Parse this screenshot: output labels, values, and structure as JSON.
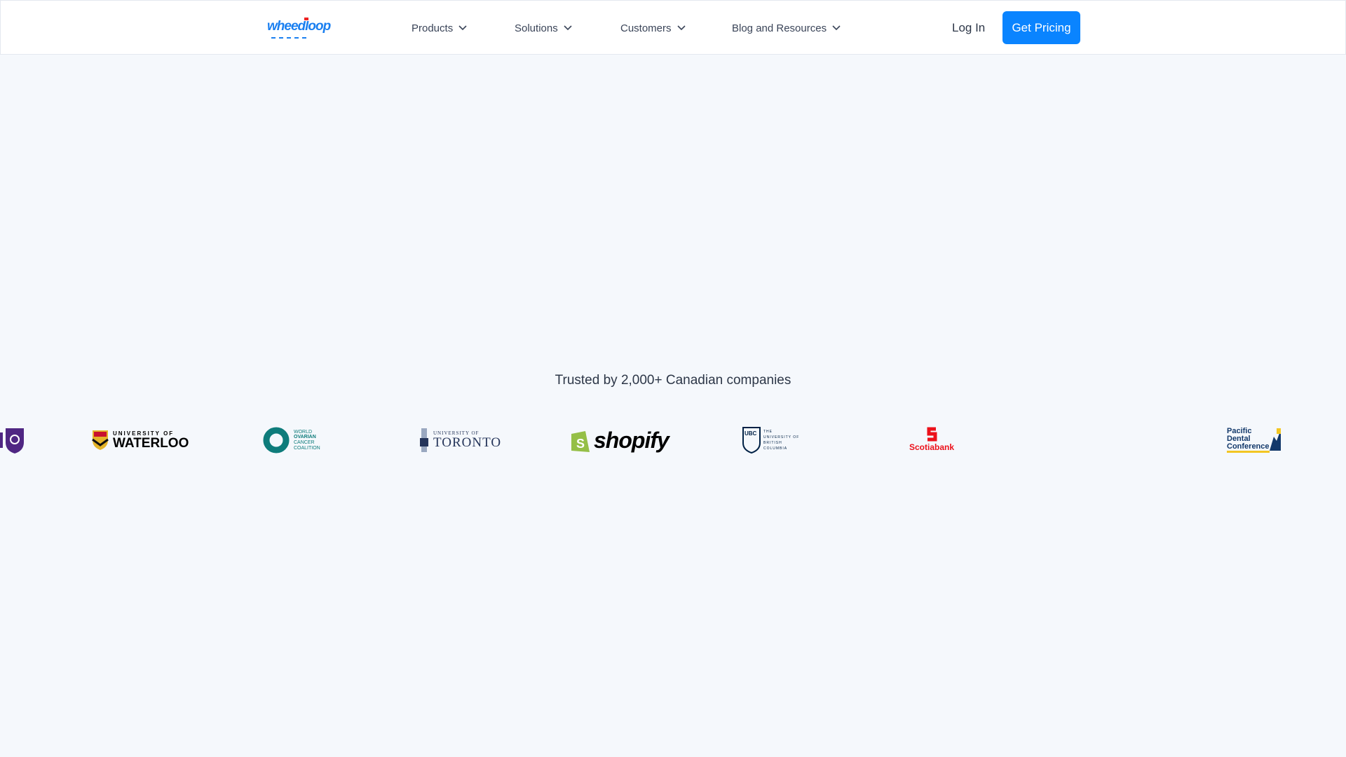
{
  "header": {
    "logo_text": "wheedloop",
    "nav": [
      {
        "label": "Products"
      },
      {
        "label": "Solutions"
      },
      {
        "label": "Customers"
      },
      {
        "label": "Blog and Resources"
      }
    ],
    "login": "Log In",
    "cta": "Get Pricing"
  },
  "trusted": {
    "text": "Trusted by 2,000+ Canadian companies",
    "logos": [
      {
        "name": "Western University",
        "text": ""
      },
      {
        "name": "University of Waterloo",
        "text": "UNIVERSITY OF WATERLOO"
      },
      {
        "name": "World Ovarian Cancer Coalition",
        "text": "WORLD OVARIAN CANCER COALITION"
      },
      {
        "name": "University of Toronto",
        "text": "UNIVERSITY OF TORONTO"
      },
      {
        "name": "Shopify",
        "text": "shopify"
      },
      {
        "name": "UBC",
        "text": "THE UNIVERSITY OF BRITISH COLUMBIA"
      },
      {
        "name": "Scotiabank",
        "text": "Scotiabank"
      },
      {
        "name": "Pacific Dental Conference",
        "text": "Pacific Dental Conference"
      }
    ]
  },
  "colors": {
    "accent": "#0a84ff",
    "bg": "#f5f8fc"
  }
}
